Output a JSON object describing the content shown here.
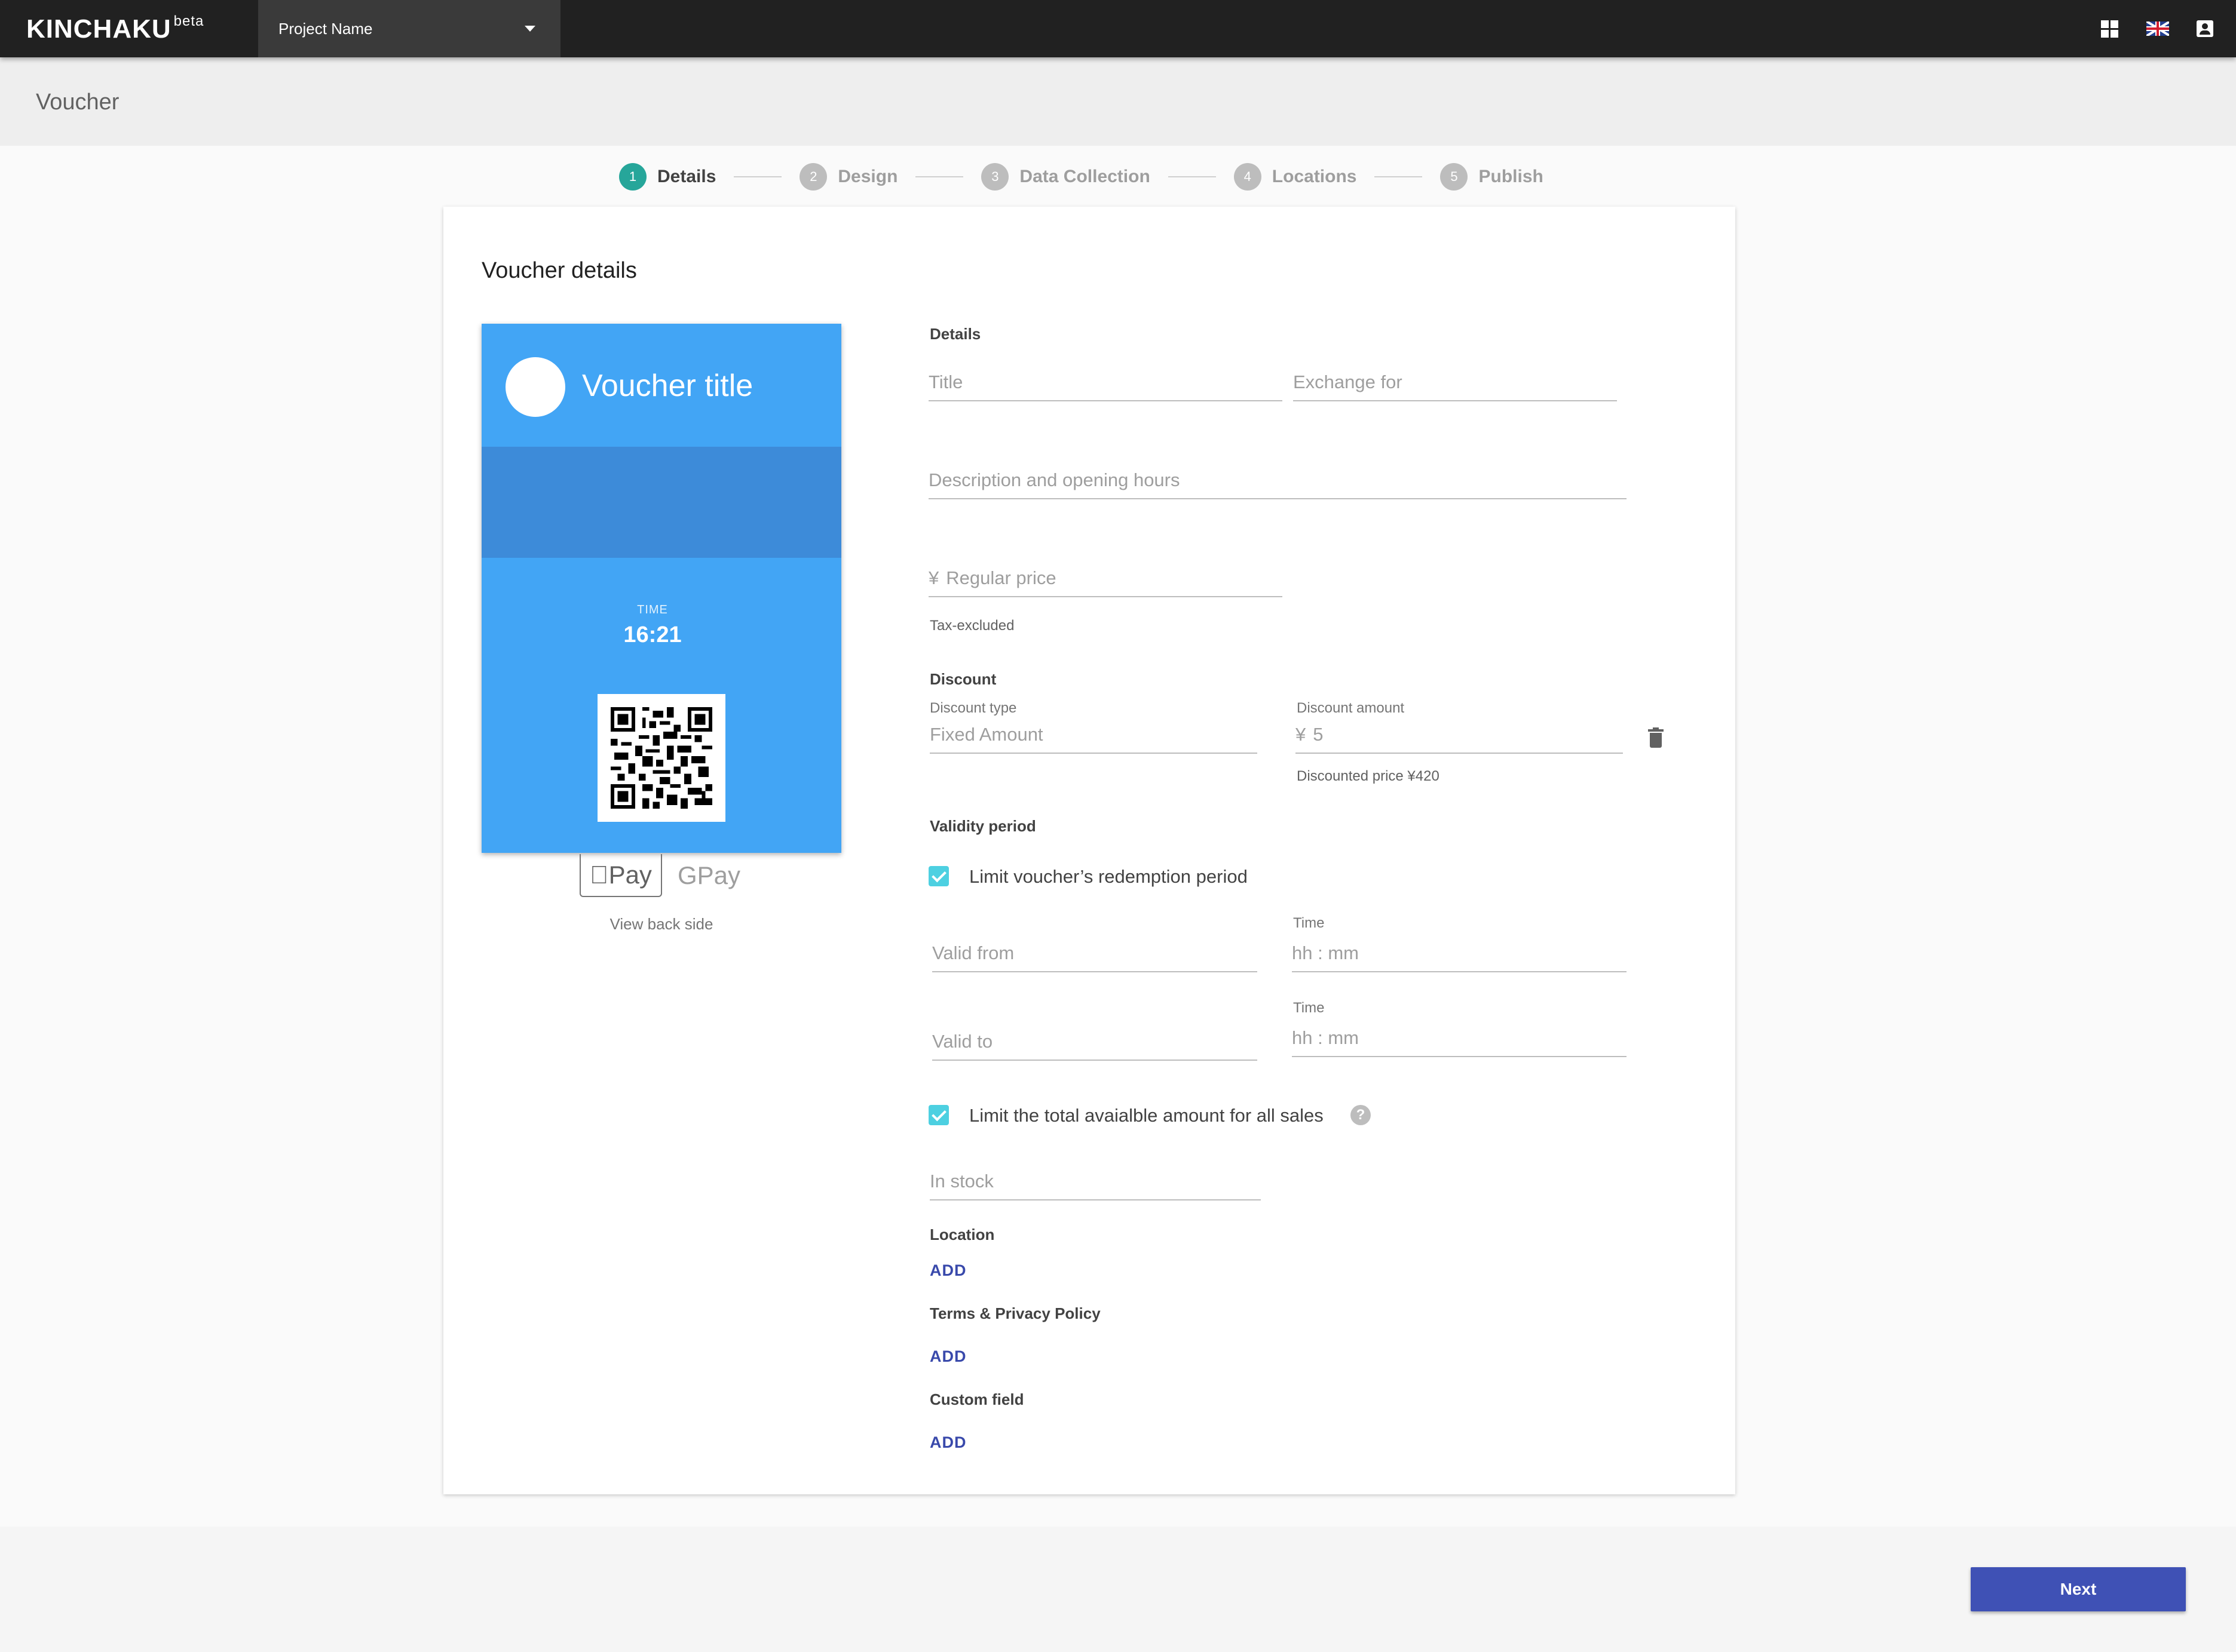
{
  "app": {
    "brand": "KINCHAKU",
    "brand_badge": "beta"
  },
  "header": {
    "project_selector": "Project Name"
  },
  "page": {
    "title": "Voucher"
  },
  "stepper": {
    "steps": [
      {
        "num": "1",
        "label": "Details",
        "active": true
      },
      {
        "num": "2",
        "label": "Design",
        "active": false
      },
      {
        "num": "3",
        "label": "Data Collection",
        "active": false
      },
      {
        "num": "4",
        "label": "Locations",
        "active": false
      },
      {
        "num": "5",
        "label": "Publish",
        "active": false
      }
    ]
  },
  "card": {
    "title": "Voucher details"
  },
  "preview": {
    "voucher_title": "Voucher title",
    "time_label": "TIME",
    "time_value": "16:21",
    "apple_pay": "Pay",
    "google_pay": "Pay",
    "view_back_side": "View back side",
    "background_color": "#42a5f5",
    "strip_color": "#3d8bd9"
  },
  "form": {
    "details_label": "Details",
    "title_placeholder": "Title",
    "exchange_placeholder": "Exchange for",
    "description_placeholder": "Description and opening hours",
    "currency_symbol": "¥",
    "regular_price_placeholder": "Regular price",
    "tax_note": "Tax-excluded",
    "discount": {
      "label": "Discount",
      "type_label": "Discount type",
      "type_value": "Fixed Amount",
      "amount_label": "Discount amount",
      "amount_value": "5",
      "discounted_price": "Discounted price ¥420"
    },
    "validity": {
      "label": "Validity period",
      "limit_period_label": "Limit voucher’s redemption period",
      "limit_period_checked": true,
      "valid_from_placeholder": "Valid from",
      "valid_to_placeholder": "Valid to",
      "time_label": "Time",
      "time_placeholder": "hh : mm"
    },
    "limit_total_label": "Limit the total avaialble amount for all sales",
    "limit_total_checked": true,
    "help_icon": "?",
    "in_stock_placeholder": "In stock",
    "location_label": "Location",
    "terms_label": "Terms & Privacy Policy",
    "custom_field_label": "Custom field",
    "add_label": "ADD"
  },
  "footer": {
    "next_label": "Next"
  },
  "colors": {
    "accent": "#26a69a",
    "checkbox": "#4dd0e1",
    "primary_button": "#3f51b5",
    "link": "#3949ab",
    "topbar": "#212121"
  },
  "icons": [
    "dashboard-icon",
    "uk-flag-icon",
    "account-icon",
    "dropdown-caret-icon",
    "trash-icon",
    "help-icon",
    "apple-icon",
    "qr-code"
  ]
}
